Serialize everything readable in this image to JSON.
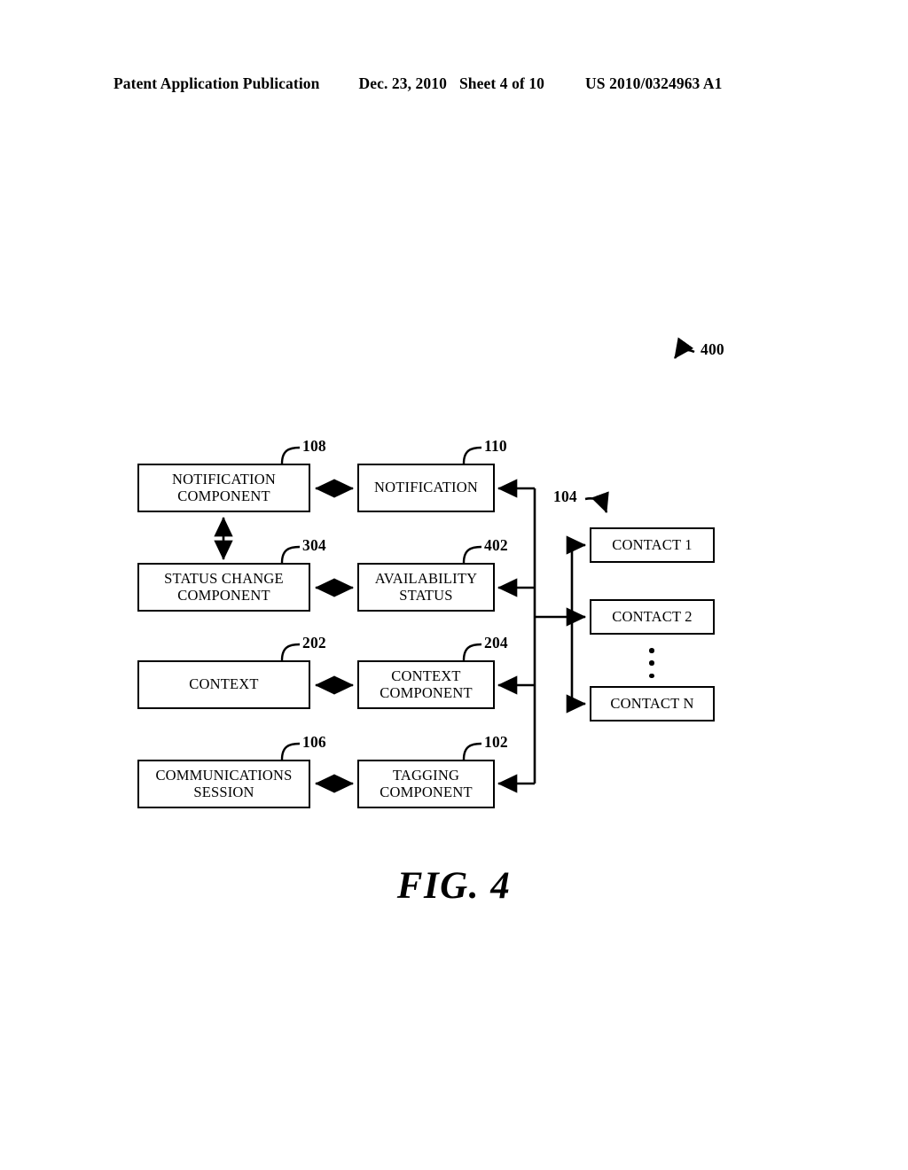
{
  "header": {
    "publication": "Patent Application Publication",
    "date": "Dec. 23, 2010",
    "sheet": "Sheet 4 of 10",
    "patent_number": "US 2010/0324963 A1"
  },
  "figure": {
    "caption": "FIG. 4",
    "figure_ref": "400",
    "group_ref": "104",
    "line_color": "#000000",
    "background_color": "#ffffff"
  },
  "nodes": [
    {
      "id": "notification-component",
      "label_line1": "NOTIFICATION",
      "label_line2": "COMPONENT",
      "ref": "108"
    },
    {
      "id": "notification",
      "label_line1": "NOTIFICATION",
      "label_line2": "",
      "ref": "110"
    },
    {
      "id": "status-change-component",
      "label_line1": "STATUS CHANGE",
      "label_line2": "COMPONENT",
      "ref": "304"
    },
    {
      "id": "availability-status",
      "label_line1": "AVAILABILITY",
      "label_line2": "STATUS",
      "ref": "402"
    },
    {
      "id": "context",
      "label_line1": "CONTEXT",
      "label_line2": "",
      "ref": "202"
    },
    {
      "id": "context-component",
      "label_line1": "CONTEXT",
      "label_line2": "COMPONENT",
      "ref": "204"
    },
    {
      "id": "communications-session",
      "label_line1": "COMMUNICATIONS",
      "label_line2": "SESSION",
      "ref": "106"
    },
    {
      "id": "tagging-component",
      "label_line1": "TAGGING",
      "label_line2": "COMPONENT",
      "ref": "102"
    }
  ],
  "contacts": [
    {
      "id": "contact-1",
      "label": "CONTACT 1"
    },
    {
      "id": "contact-2",
      "label": "CONTACT 2"
    },
    {
      "id": "contact-n",
      "label": "CONTACT N"
    }
  ],
  "connections": [
    {
      "from": "notification-component",
      "to": "notification",
      "type": "double-arrow",
      "orientation": "horizontal"
    },
    {
      "from": "notification-component",
      "to": "status-change-component",
      "type": "double-arrow",
      "orientation": "vertical"
    },
    {
      "from": "status-change-component",
      "to": "availability-status",
      "type": "double-arrow",
      "orientation": "horizontal"
    },
    {
      "from": "context",
      "to": "context-component",
      "type": "double-arrow",
      "orientation": "horizontal"
    },
    {
      "from": "communications-session",
      "to": "tagging-component",
      "type": "double-arrow",
      "orientation": "horizontal"
    },
    {
      "from": "contacts-bus",
      "to": "notification",
      "type": "single-arrow",
      "orientation": "horizontal"
    },
    {
      "from": "contacts-bus",
      "to": "availability-status",
      "type": "single-arrow",
      "orientation": "horizontal"
    },
    {
      "from": "contacts-bus",
      "to": "context-component",
      "type": "single-arrow",
      "orientation": "horizontal"
    },
    {
      "from": "contacts-bus",
      "to": "tagging-component",
      "type": "single-arrow",
      "orientation": "horizontal"
    },
    {
      "from": "contacts-bus",
      "to": "contact-1",
      "type": "single-arrow",
      "orientation": "horizontal"
    },
    {
      "from": "contacts-bus",
      "to": "contact-2",
      "type": "single-arrow",
      "orientation": "horizontal"
    },
    {
      "from": "contacts-bus",
      "to": "contact-n",
      "type": "single-arrow",
      "orientation": "horizontal"
    }
  ]
}
